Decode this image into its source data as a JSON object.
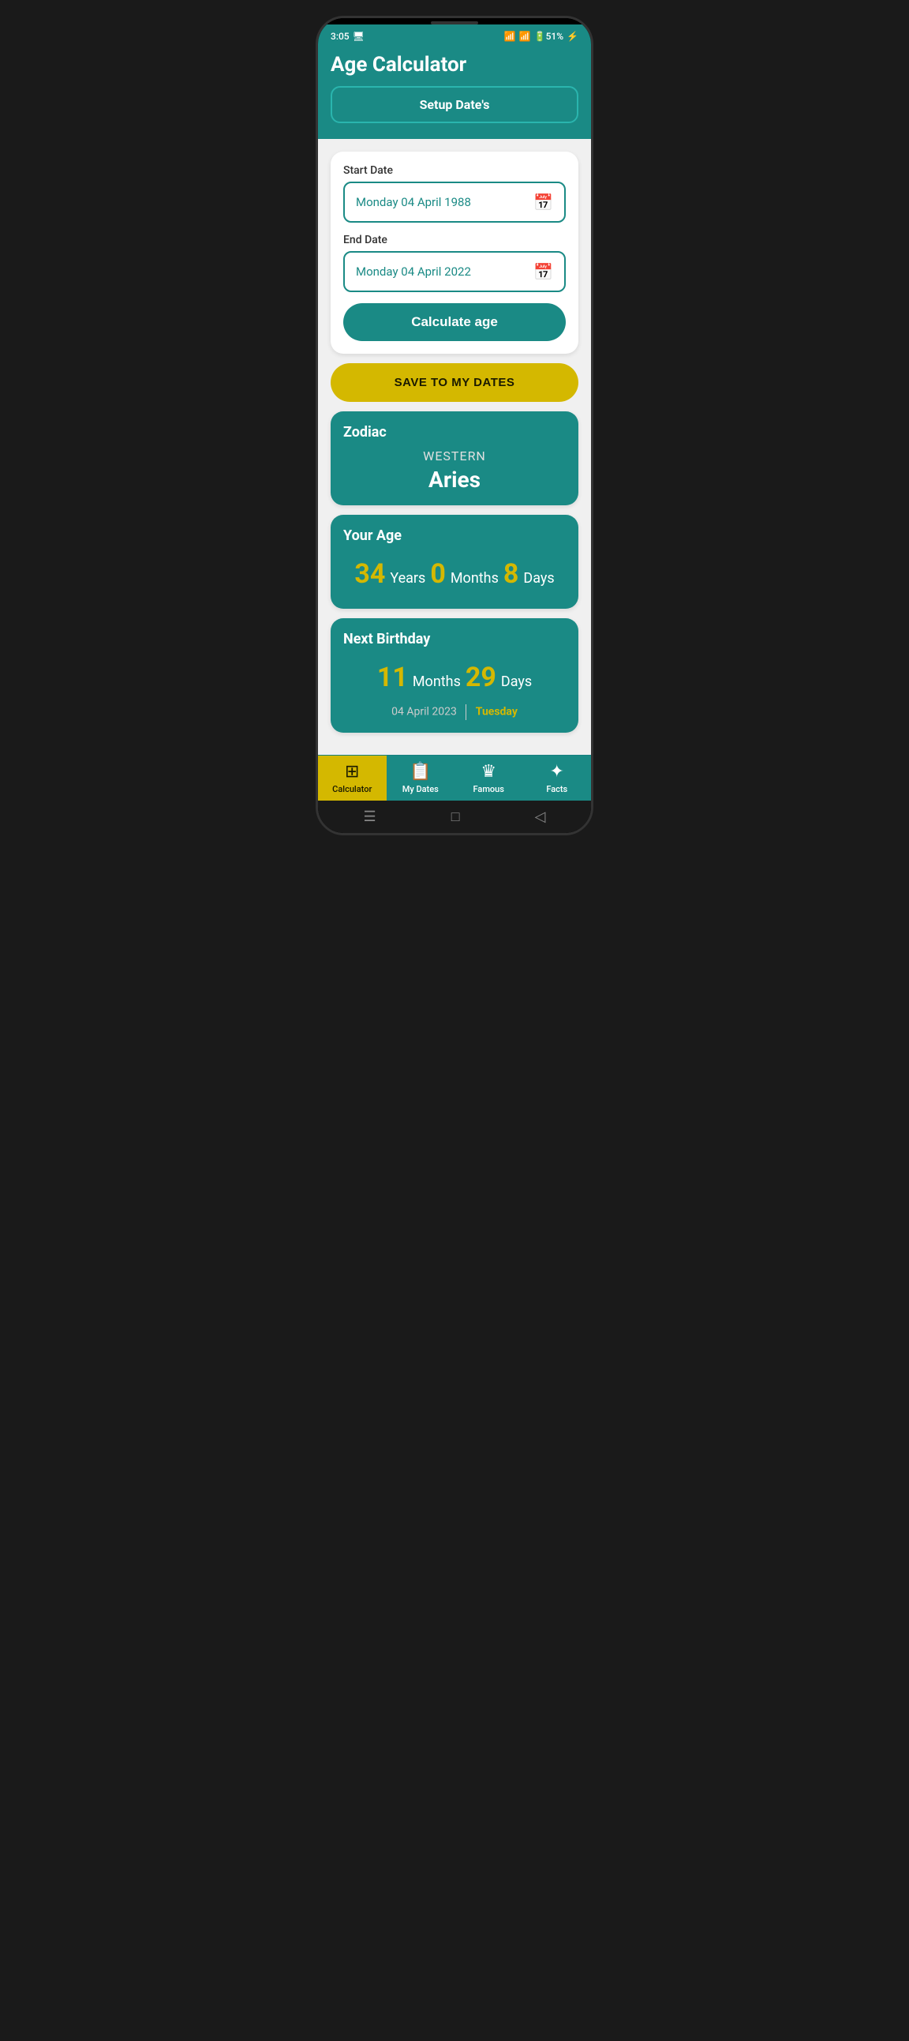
{
  "status": {
    "time": "3:05",
    "battery": "51"
  },
  "header": {
    "title": "Age Calculator",
    "setup_btn": "Setup Date's"
  },
  "form": {
    "start_label": "Start Date",
    "start_date": "Monday 04 April 1988",
    "end_label": "End Date",
    "end_date": "Monday 04 April 2022",
    "calculate_btn": "Calculate age"
  },
  "save_btn": "SAVE TO MY DATES",
  "zodiac": {
    "title": "Zodiac",
    "type": "WESTERN",
    "sign": "Aries"
  },
  "age": {
    "title": "Your Age",
    "years": "34",
    "years_label": "Years",
    "months": "0",
    "months_label": "Months",
    "days": "8",
    "days_label": "Days"
  },
  "birthday": {
    "title": "Next Birthday",
    "months": "11",
    "months_label": "Months",
    "days": "29",
    "days_label": "Days",
    "date": "04 April 2023",
    "day": "Tuesday"
  },
  "nav": {
    "items": [
      {
        "id": "calculator",
        "label": "Calculator",
        "icon": "⊞",
        "active": true
      },
      {
        "id": "my-dates",
        "label": "My Dates",
        "icon": "📋",
        "active": false
      },
      {
        "id": "famous",
        "label": "Famous",
        "icon": "♛",
        "active": false
      },
      {
        "id": "facts",
        "label": "Facts",
        "icon": "✦",
        "active": false
      }
    ]
  },
  "android_nav": {
    "menu": "☰",
    "home": "□",
    "back": "◁"
  }
}
